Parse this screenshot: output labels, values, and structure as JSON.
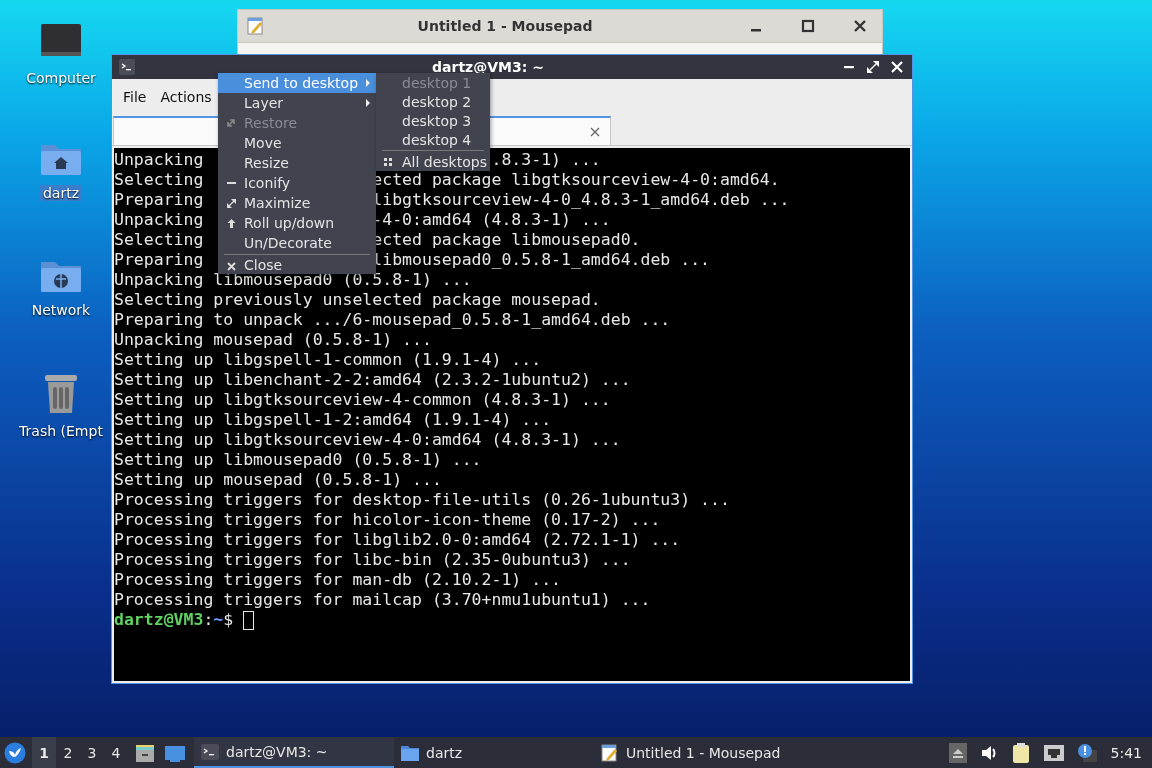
{
  "desktop_icons": [
    {
      "label": "Computer",
      "kind": "computer"
    },
    {
      "label": "dartz",
      "kind": "home",
      "selected": true
    },
    {
      "label": "Network",
      "kind": "network"
    },
    {
      "label": "Trash (Empt",
      "kind": "trash"
    }
  ],
  "mousepad_window": {
    "title": "Untitled 1 - Mousepad"
  },
  "terminal_window": {
    "title": "dartz@VM3: ~",
    "menu": [
      "File",
      "Actions"
    ],
    "lines": [
      {
        "left": "Unpacking ",
        "right": ".8.3-1) ...",
        "kind": "behind_submenu"
      },
      {
        "left": "Selecting ",
        "right": "ected package libgtksourceview-4-0:amd64.",
        "kind": "behind_menu"
      },
      {
        "left": "Preparing ",
        "right": "libgtksourceview-4-0_4.8.3-1_amd64.deb ...",
        "kind": "behind_menu"
      },
      {
        "left": "Unpacking ",
        "right": "-4-0:amd64 (4.8.3-1) ...",
        "kind": "behind_menu"
      },
      {
        "left": "Selecting ",
        "right": "ected package libmousepad0.",
        "kind": "behind_menu"
      },
      {
        "left": "Preparing ",
        "right": "libmousepad0_0.5.8-1_amd64.deb ...",
        "kind": "behind_menu"
      },
      {
        "left": "Unpacking libmousepad0 (0.5.8-1) ..."
      },
      {
        "left": "Selecting previously unselected package mousepad."
      },
      {
        "left": "Preparing to unpack .../6-mousepad_0.5.8-1_amd64.deb ..."
      },
      {
        "left": "Unpacking mousepad (0.5.8-1) ..."
      },
      {
        "left": "Setting up libgspell-1-common (1.9.1-4) ..."
      },
      {
        "left": "Setting up libenchant-2-2:amd64 (2.3.2-1ubuntu2) ..."
      },
      {
        "left": "Setting up libgtksourceview-4-common (4.8.3-1) ..."
      },
      {
        "left": "Setting up libgspell-1-2:amd64 (1.9.1-4) ..."
      },
      {
        "left": "Setting up libgtksourceview-4-0:amd64 (4.8.3-1) ..."
      },
      {
        "left": "Setting up libmousepad0 (0.5.8-1) ..."
      },
      {
        "left": "Setting up mousepad (0.5.8-1) ..."
      },
      {
        "left": "Processing triggers for desktop-file-utils (0.26-1ubuntu3) ..."
      },
      {
        "left": "Processing triggers for hicolor-icon-theme (0.17-2) ..."
      },
      {
        "left": "Processing triggers for libglib2.0-0:amd64 (2.72.1-1) ..."
      },
      {
        "left": "Processing triggers for libc-bin (2.35-0ubuntu3) ..."
      },
      {
        "left": "Processing triggers for man-db (2.10.2-1) ..."
      },
      {
        "left": "Processing triggers for mailcap (3.70+nmu1ubuntu1) ..."
      }
    ],
    "prompt": [
      {
        "text": "dartz@VM3",
        "kind": "user"
      },
      {
        "text": ":",
        "kind": "plain"
      },
      {
        "text": "~",
        "kind": "path"
      },
      {
        "text": "$",
        "kind": "plain"
      }
    ]
  },
  "window_menu": {
    "items": [
      {
        "label": "Send to desktop",
        "kind": "submenu",
        "selected": true,
        "disabled": false
      },
      {
        "label": "Layer",
        "kind": "submenu",
        "selected": false,
        "disabled": false
      },
      {
        "label": "Restore",
        "kind": "restore",
        "selected": false,
        "disabled": true
      },
      {
        "label": "Move",
        "kind": "plain",
        "selected": false,
        "disabled": false
      },
      {
        "label": "Resize",
        "kind": "plain",
        "selected": false,
        "disabled": false
      },
      {
        "label": "Iconify",
        "kind": "iconify",
        "selected": false,
        "disabled": false
      },
      {
        "label": "Maximize",
        "kind": "maximize",
        "selected": false,
        "disabled": false
      },
      {
        "label": "Roll up/down",
        "kind": "rollup",
        "selected": false,
        "disabled": false
      },
      {
        "label": "Un/Decorate",
        "kind": "plain",
        "selected": false,
        "disabled": false
      },
      {
        "label": "Close",
        "kind": "close",
        "selected": false,
        "disabled": false
      }
    ]
  },
  "desktop_submenu": {
    "items": [
      {
        "label": "desktop 1",
        "kind": "plain",
        "disabled": true
      },
      {
        "label": "desktop 2",
        "kind": "plain",
        "disabled": false
      },
      {
        "label": "desktop 3",
        "kind": "plain",
        "disabled": false
      },
      {
        "label": "desktop 4",
        "kind": "plain",
        "disabled": false
      },
      {
        "label": "All desktops",
        "kind": "all",
        "disabled": false
      }
    ]
  },
  "taskbar": {
    "workspaces": [
      {
        "label": "1",
        "selected": true
      },
      {
        "label": "2",
        "selected": false
      },
      {
        "label": "3",
        "selected": false
      },
      {
        "label": "4",
        "selected": false
      }
    ],
    "tasks": [
      {
        "label": "dartz@VM3: ~",
        "kind": "terminal",
        "selected": true
      },
      {
        "label": "dartz",
        "kind": "folder",
        "selected": false
      },
      {
        "label": "Untitled 1 - Mousepad",
        "kind": "editor",
        "selected": false
      }
    ],
    "clock": "5:41"
  }
}
